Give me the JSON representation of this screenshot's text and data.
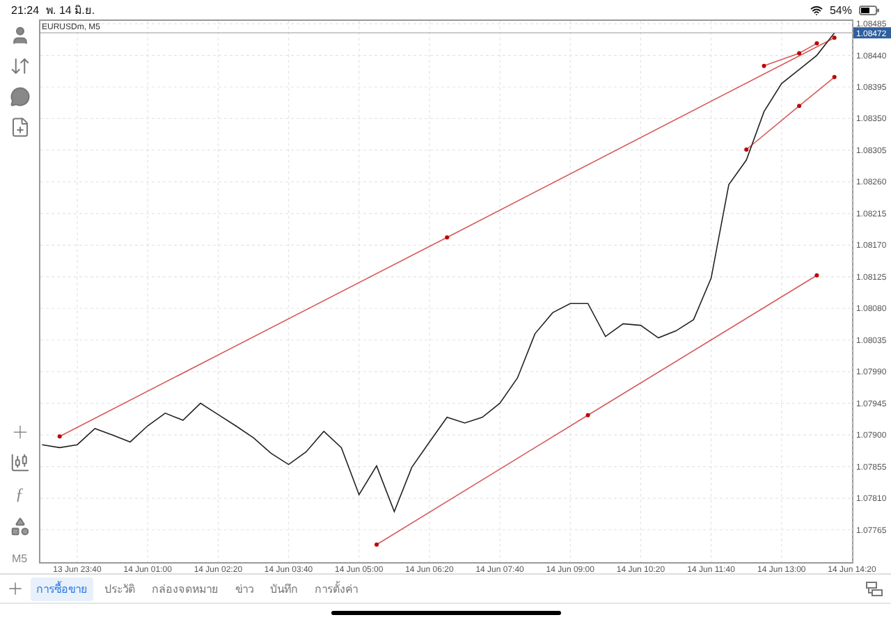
{
  "status_bar": {
    "time": "21:24",
    "date": "พ. 14 มิ.ย.",
    "battery": "54%"
  },
  "sidebar": {
    "top_tools": [
      {
        "kind": "account"
      },
      {
        "kind": "trade"
      },
      {
        "kind": "chat"
      },
      {
        "kind": "new"
      }
    ],
    "bottom_tools": [
      {
        "kind": "crosshair"
      },
      {
        "kind": "candles"
      },
      {
        "kind": "function",
        "text": "ƒ"
      },
      {
        "kind": "objects"
      },
      {
        "kind": "timeframe",
        "text": "M5"
      }
    ]
  },
  "chart": {
    "symbol": "EURUSDm, M5",
    "chart_data": {
      "type": "line",
      "categories": [
        null,
        null,
        "13 Jun 23:40",
        null,
        null,
        null,
        "14 Jun 01:00",
        null,
        null,
        null,
        "14 Jun 02:20",
        null,
        null,
        null,
        "14 Jun 03:40",
        null,
        null,
        null,
        "14 Jun 05:00",
        null,
        null,
        null,
        "14 Jun 06:20",
        null,
        null,
        null,
        "14 Jun 07:40",
        null,
        null,
        null,
        "14 Jun 09:00",
        null,
        null,
        null,
        "14 Jun 10:20",
        null,
        null,
        null,
        "14 Jun 11:40",
        null,
        null,
        null,
        "14 Jun 13:00",
        null,
        null,
        null,
        "14 Jun 14:20"
      ],
      "series": [
        {
          "color": "#222222",
          "values": [
            1.07886,
            1.07882,
            1.07886,
            1.07909,
            1.079,
            1.0789,
            1.07913,
            1.07931,
            1.07921,
            1.07945,
            1.07929,
            1.07913,
            1.07896,
            1.07874,
            1.07858,
            1.07876,
            1.07905,
            1.07882,
            1.07815,
            1.07856,
            1.07791,
            1.07854,
            1.0789,
            1.07925,
            1.07917,
            1.07925,
            1.07945,
            1.07981,
            1.08044,
            1.08074,
            1.08087,
            1.08087,
            1.0804,
            1.08058,
            1.08056,
            1.08038,
            1.08048,
            1.08064,
            1.08123,
            1.08256,
            1.08291,
            1.0836,
            1.084,
            1.0842,
            1.0844,
            1.08472,
            null
          ]
        },
        {
          "color": "#c00000",
          "marker": "o",
          "values": [
            null,
            1.07898,
            null,
            null,
            null,
            null,
            null,
            null,
            null,
            null,
            null,
            null,
            null,
            null,
            null,
            null,
            null,
            null,
            null,
            null,
            null,
            null,
            null,
            1.08181,
            null,
            null,
            null,
            null,
            null,
            null,
            null,
            null,
            null,
            null,
            null,
            null,
            null,
            null,
            null,
            null,
            null,
            null,
            null,
            null,
            null,
            1.08465,
            null
          ]
        },
        {
          "color": "#c00000",
          "marker": "o",
          "values": [
            null,
            null,
            null,
            null,
            null,
            null,
            null,
            null,
            null,
            null,
            null,
            null,
            null,
            null,
            null,
            null,
            null,
            null,
            null,
            null,
            null,
            null,
            null,
            null,
            null,
            null,
            null,
            null,
            null,
            null,
            null,
            null,
            null,
            null,
            null,
            null,
            null,
            null,
            null,
            null,
            null,
            1.08425,
            null,
            1.08443,
            1.08457,
            null,
            null
          ]
        },
        {
          "color": "#c00000",
          "marker": "o",
          "values": [
            null,
            null,
            null,
            null,
            null,
            null,
            null,
            null,
            null,
            null,
            null,
            null,
            null,
            null,
            null,
            null,
            null,
            null,
            null,
            1.07744,
            null,
            null,
            null,
            null,
            null,
            null,
            null,
            null,
            null,
            null,
            null,
            1.07928,
            null,
            null,
            null,
            null,
            null,
            null,
            null,
            null,
            null,
            null,
            null,
            null,
            1.08127,
            null,
            null
          ]
        },
        {
          "color": "#c00000",
          "marker": "o",
          "values": [
            null,
            null,
            null,
            null,
            null,
            null,
            null,
            null,
            null,
            null,
            null,
            null,
            null,
            null,
            null,
            null,
            null,
            null,
            null,
            null,
            null,
            null,
            null,
            null,
            null,
            null,
            null,
            null,
            null,
            null,
            null,
            null,
            null,
            null,
            null,
            null,
            null,
            null,
            null,
            null,
            1.08306,
            null,
            null,
            1.08368,
            null,
            1.08409,
            null
          ]
        }
      ],
      "ylim": [
        1.07719,
        1.08491
      ],
      "yticks": [
        {
          "value": 1.08485,
          "label": "1.08485"
        },
        {
          "value": 1.0844,
          "label": "1.08440"
        },
        {
          "value": 1.08395,
          "label": "1.08395"
        },
        {
          "value": 1.0835,
          "label": "1.08350"
        },
        {
          "value": 1.08305,
          "label": "1.08305"
        },
        {
          "value": 1.0826,
          "label": "1.08260"
        },
        {
          "value": 1.08215,
          "label": "1.08215"
        },
        {
          "value": 1.0817,
          "label": "1.08170"
        },
        {
          "value": 1.08125,
          "label": "1.08125"
        },
        {
          "value": 1.0808,
          "label": "1.08080"
        },
        {
          "value": 1.08035,
          "label": "1.08035"
        },
        {
          "value": 1.0799,
          "label": "1.07990"
        },
        {
          "value": 1.07945,
          "label": "1.07945"
        },
        {
          "value": 1.079,
          "label": "1.07900"
        },
        {
          "value": 1.07855,
          "label": "1.07855"
        },
        {
          "value": 1.0781,
          "label": "1.07810"
        },
        {
          "value": 1.07765,
          "label": "1.07765"
        }
      ],
      "grid": true,
      "ref_lines": [
        {
          "axis": "y",
          "value": 1.08472,
          "label": "1.08472",
          "color": "#aaaaaa"
        }
      ]
    }
  },
  "tabs": [
    {
      "label": "การซื้อขาย",
      "selected": true
    },
    {
      "label": "ประวัติ",
      "selected": false
    },
    {
      "label": "กล่องจดหมาย",
      "selected": false
    },
    {
      "label": "ข่าว",
      "selected": false
    },
    {
      "label": "บันทึก",
      "selected": false
    },
    {
      "label": "การตั้งค่า",
      "selected": false
    }
  ]
}
